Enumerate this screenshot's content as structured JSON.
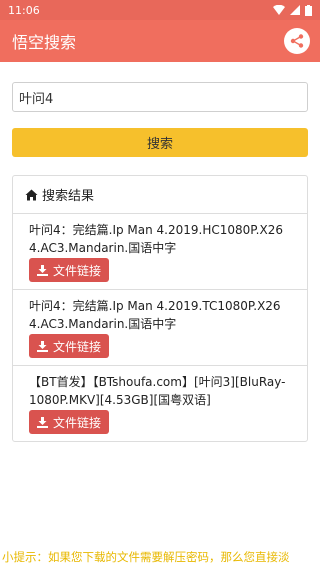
{
  "status": {
    "time": "11:06"
  },
  "appbar": {
    "title": "悟空搜索"
  },
  "search": {
    "value": "叶问4",
    "button_label": "搜索"
  },
  "results": {
    "header": "搜索结果",
    "items": [
      {
        "title": "叶问4：完结篇.Ip Man 4.2019.HC1080P.X264.AC3.Mandarin.国语中字",
        "button_label": "文件链接"
      },
      {
        "title": "叶问4：完结篇.Ip Man 4.2019.TC1080P.X264.AC3.Mandarin.国语中字",
        "button_label": "文件链接"
      },
      {
        "title": "【BT首发】【BTshoufa.com】[叶问3][BluRay-1080P.MKV][4.53GB][国粤双语]",
        "button_label": "文件链接"
      }
    ]
  },
  "footer": {
    "tip": "小提示：如果您下载的文件需要解压密码，那么您直接淡"
  },
  "colors": {
    "accent": "#f06e5e",
    "button": "#f6c02c",
    "download": "#d9534f",
    "tip": "#e8b800"
  },
  "icons": [
    "wifi-icon",
    "signal-icon",
    "battery-icon",
    "share-icon",
    "home-icon",
    "download-icon"
  ]
}
